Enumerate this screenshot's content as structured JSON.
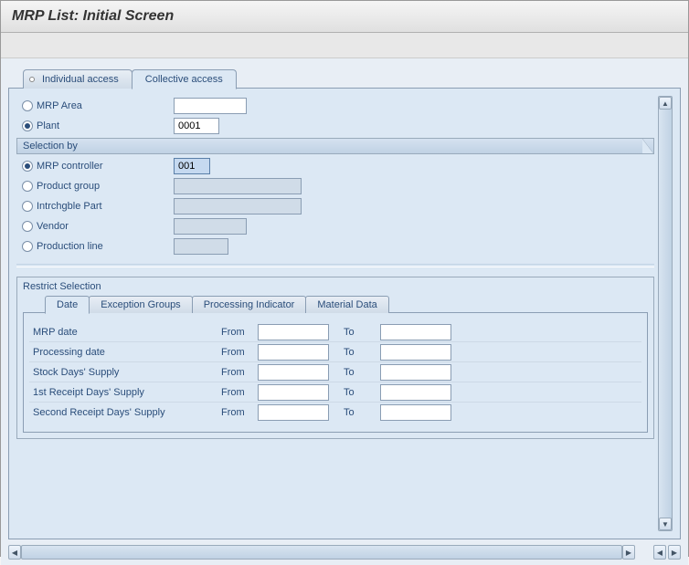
{
  "title": "MRP List: Initial Screen",
  "mainTabs": {
    "individual": "Individual access",
    "collective": "Collective access"
  },
  "top": {
    "mrpAreaLabel": "MRP Area",
    "mrpAreaValue": "",
    "plantLabel": "Plant",
    "plantValue": "0001"
  },
  "selectionBy": {
    "header": "Selection by",
    "mrpControllerLabel": "MRP controller",
    "mrpControllerValue": "001",
    "productGroupLabel": "Product group",
    "productGroupValue": "",
    "intrchgblePartLabel": "Intrchgble Part",
    "intrchgblePartValue": "",
    "vendorLabel": "Vendor",
    "vendorValue": "",
    "productionLineLabel": "Production line",
    "productionLineValue": ""
  },
  "restrict": {
    "header": "Restrict Selection",
    "tabs": {
      "date": "Date",
      "exceptionGroups": "Exception Groups",
      "processingIndicator": "Processing Indicator",
      "materialData": "Material Data"
    },
    "fromLabel": "From",
    "toLabel": "To",
    "rows": {
      "mrpDate": "MRP date",
      "processingDate": "Processing date",
      "stockDaysSupply": "Stock Days' Supply",
      "firstReceiptDaysSupply": "1st Receipt Days' Supply",
      "secondReceiptDaysSupply": "Second Receipt Days' Supply"
    }
  }
}
